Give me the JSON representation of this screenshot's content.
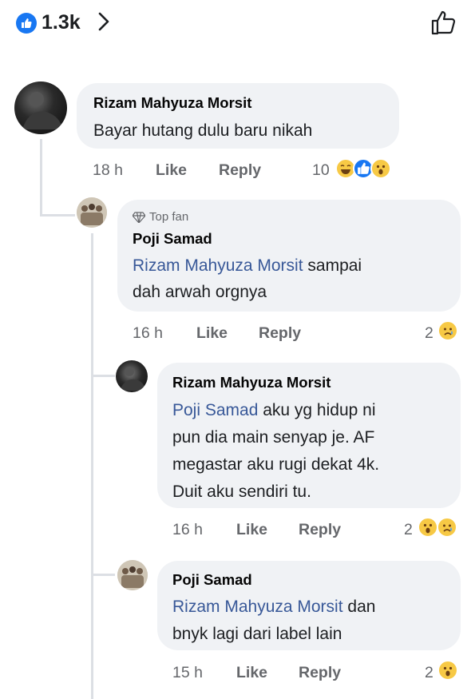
{
  "header": {
    "reaction_count": "1.3k"
  },
  "comments": [
    {
      "name": "Rizam Mahyuza Morsit",
      "text": "Bayar hutang dulu baru nikah",
      "time": "18 h",
      "like": "Like",
      "reply": "Reply",
      "reactions": "10",
      "reaction_icons": [
        "laugh-emoji",
        "like-reaction",
        "wow-emoji"
      ]
    },
    {
      "badge": "Top fan",
      "name": "Poji Samad",
      "mention": "Rizam Mahyuza Morsit",
      "text_line1": " sampai",
      "text_line2": "dah arwah orgnya",
      "time": "16 h",
      "like": "Like",
      "reply": "Reply",
      "reactions": "2",
      "reaction_icons": [
        "sad-emoji"
      ]
    },
    {
      "name": "Rizam Mahyuza Morsit",
      "mention": "Poji Samad",
      "text_line1": " aku yg hidup ni",
      "text_line2": "pun dia main senyap je. AF",
      "text_line3": "megastar aku rugi dekat 4k.",
      "text_line4": "Duit aku sendiri tu.",
      "time": "16 h",
      "like": "Like",
      "reply": "Reply",
      "reactions": "2",
      "reaction_icons": [
        "wow-emoji",
        "sad-emoji"
      ]
    },
    {
      "name": "Poji Samad",
      "mention": "Rizam Mahyuza Morsit",
      "text_line1": " dan",
      "text_line2": "bnyk lagi dari label lain",
      "time": "15 h",
      "like": "Like",
      "reply": "Reply",
      "reactions": "2",
      "reaction_icons": [
        "wow-emoji"
      ]
    }
  ]
}
